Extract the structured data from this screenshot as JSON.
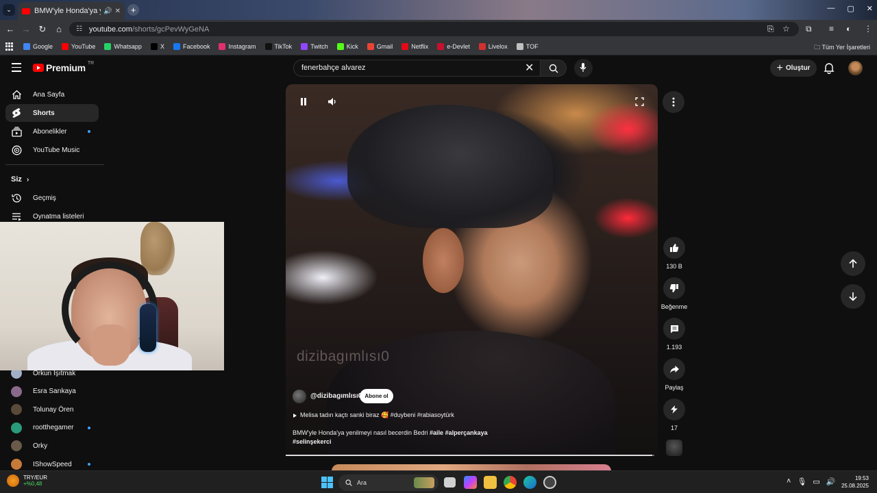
{
  "browser": {
    "tab_title": "BMW'yle Honda'ya yenilmeyi",
    "url_host": "youtube.com",
    "url_path": "/shorts/gcPevWyGeNA",
    "bookmarks": [
      {
        "label": "Google",
        "color": "#4285f4"
      },
      {
        "label": "YouTube",
        "color": "#ff0000"
      },
      {
        "label": "Whatsapp",
        "color": "#25d366"
      },
      {
        "label": "X",
        "color": "#000000"
      },
      {
        "label": "Facebook",
        "color": "#1877f2"
      },
      {
        "label": "Instagram",
        "color": "#e1306c"
      },
      {
        "label": "TikTok",
        "color": "#111111"
      },
      {
        "label": "Twitch",
        "color": "#9146ff"
      },
      {
        "label": "Kick",
        "color": "#53fc18"
      },
      {
        "label": "Gmail",
        "color": "#ea4335"
      },
      {
        "label": "Netflix",
        "color": "#e50914"
      },
      {
        "label": "e-Devlet",
        "color": "#c8102e"
      },
      {
        "label": "Livelox",
        "color": "#d03030"
      },
      {
        "label": "TOF",
        "color": "#c0c0c0"
      }
    ],
    "all_bookmarks": "Tüm Yer İşaretleri"
  },
  "youtube": {
    "logo_word": "Premium",
    "country": "TR",
    "search_value": "fenerbahçe alvarez",
    "create_label": "Oluştur",
    "sidebar": {
      "main": [
        {
          "label": "Ana Sayfa",
          "icon": "home-icon"
        },
        {
          "label": "Shorts",
          "icon": "shorts-icon"
        },
        {
          "label": "Abonelikler",
          "icon": "subscriptions-icon"
        },
        {
          "label": "YouTube Music",
          "icon": "music-icon"
        }
      ],
      "you_header": "Siz",
      "you": [
        {
          "label": "Geçmiş",
          "icon": "history-icon"
        },
        {
          "label": "Oynatma listeleri",
          "icon": "playlists-icon"
        }
      ],
      "subscriptions": [
        {
          "label": "Orkun Işıtmak",
          "color": "#a0b0c8",
          "dot": false
        },
        {
          "label": "Esra Sarıkaya",
          "color": "#8a6a8a",
          "dot": false
        },
        {
          "label": "Tolunay Ören",
          "color": "#5a4a3a",
          "dot": false
        },
        {
          "label": "rootthegamer",
          "color": "#2a9a7a",
          "dot": true
        },
        {
          "label": "Orky",
          "color": "#6a5a4a",
          "dot": false
        },
        {
          "label": "IShowSpeed",
          "color": "#c87a3a",
          "dot": true
        }
      ]
    },
    "short": {
      "watermark": "dizibagımlısı0",
      "channel": "@dizibagımlısı0",
      "subscribe_label": "Abone ol",
      "sound": "Melisa tadın kaçtı sanki biraz 🥰 #duybeni #rabiasoytürk",
      "caption_text": "BMW'yle Honda'ya yenilmeyi nasıl becerdin Bedri",
      "caption_tags": "#aile #alperçankaya #selinşekerci",
      "progress": 0.995
    },
    "actions": {
      "likes": "130 B",
      "dislike": "Beğenme",
      "comments": "1.193",
      "share": "Paylaş",
      "remix": "17"
    }
  },
  "taskbar": {
    "ticker_name": "TRY/EUR",
    "ticker_change": "+%0,48",
    "search_placeholder": "Ara",
    "time": "19:53",
    "date": "25.08.2025"
  }
}
